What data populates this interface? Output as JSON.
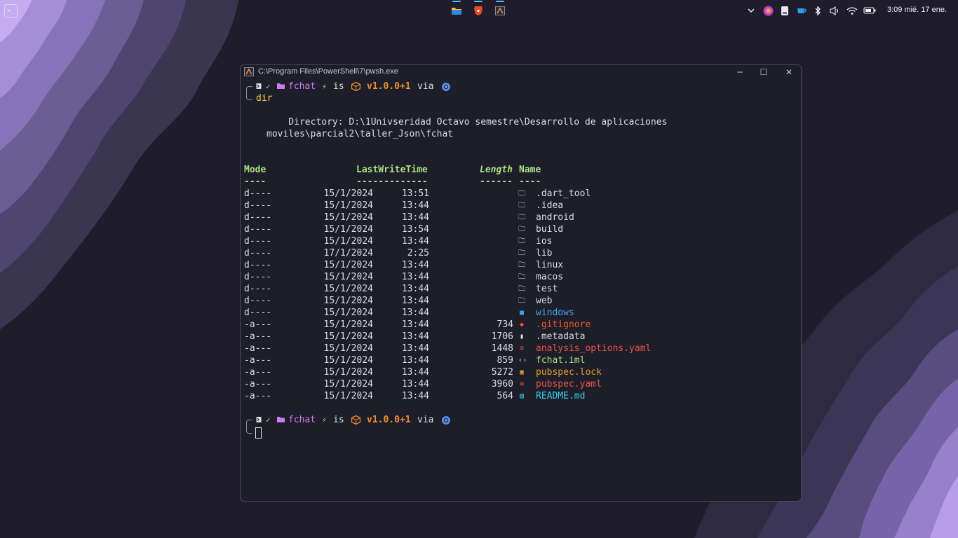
{
  "taskbar": {
    "apps": [
      {
        "name": "file-explorer",
        "icon": "folder-icon"
      },
      {
        "name": "brave-browser",
        "icon": "brave-lion-icon"
      },
      {
        "name": "terminal",
        "icon": "terminal-app-icon"
      }
    ],
    "tray_icons": [
      "chevron-up-icon",
      "app-tray-icon",
      "usb-drive-icon",
      "cup-icon",
      "bluetooth-icon",
      "volume-icon",
      "wifi-icon",
      "battery-icon"
    ],
    "clock": "3:09  mié. 17 ene."
  },
  "window": {
    "title": "C:\\Program Files\\PowerShell\\7\\pwsh.exe",
    "controls": {
      "minimize": "─",
      "maximize": "☐",
      "close": "✕"
    }
  },
  "terminal": {
    "prompt": {
      "segment_check": "✓",
      "dir": "fchat",
      "bolt": "⚡",
      "is": "is",
      "version": "v1.0.0+1",
      "via": "via"
    },
    "command": "dir",
    "directory_line1": "    Directory: D:\\1Univseridad Octavo semestre\\Desarrollo de aplicaciones",
    "directory_line2": "moviles\\parcial2\\taller_Json\\fchat",
    "headers": {
      "mode": "Mode",
      "lastwrite": "LastWriteTime",
      "length": "Length",
      "name": "Name"
    },
    "header_underlines": {
      "mode": "----",
      "lastwrite": "-------------",
      "length": "------",
      "name": "----"
    },
    "entries": [
      {
        "mode": "d----",
        "date": "15/1/2024",
        "time": "13:51",
        "length": "",
        "icon": "folder-icon",
        "name": ".dart_tool",
        "color": "#dcdce6"
      },
      {
        "mode": "d----",
        "date": "15/1/2024",
        "time": "13:44",
        "length": "",
        "icon": "folder-icon",
        "name": ".idea",
        "color": "#dcdce6"
      },
      {
        "mode": "d----",
        "date": "15/1/2024",
        "time": "13:44",
        "length": "",
        "icon": "folder-icon",
        "name": "android",
        "color": "#dcdce6"
      },
      {
        "mode": "d----",
        "date": "15/1/2024",
        "time": "13:54",
        "length": "",
        "icon": "folder-icon",
        "name": "build",
        "color": "#dcdce6"
      },
      {
        "mode": "d----",
        "date": "15/1/2024",
        "time": "13:44",
        "length": "",
        "icon": "folder-icon",
        "name": "ios",
        "color": "#dcdce6"
      },
      {
        "mode": "d----",
        "date": "17/1/2024",
        "time": "2:25",
        "length": "",
        "icon": "folder-icon",
        "name": "lib",
        "color": "#dcdce6"
      },
      {
        "mode": "d----",
        "date": "15/1/2024",
        "time": "13:44",
        "length": "",
        "icon": "folder-icon",
        "name": "linux",
        "color": "#dcdce6"
      },
      {
        "mode": "d----",
        "date": "15/1/2024",
        "time": "13:44",
        "length": "",
        "icon": "folder-icon",
        "name": "macos",
        "color": "#dcdce6"
      },
      {
        "mode": "d----",
        "date": "15/1/2024",
        "time": "13:44",
        "length": "",
        "icon": "folder-icon",
        "name": "test",
        "color": "#dcdce6"
      },
      {
        "mode": "d----",
        "date": "15/1/2024",
        "time": "13:44",
        "length": "",
        "icon": "folder-icon",
        "name": "web",
        "color": "#dcdce6"
      },
      {
        "mode": "d----",
        "date": "15/1/2024",
        "time": "13:44",
        "length": "",
        "icon": "windows-icon",
        "name": "windows",
        "color": "#3aa6e8"
      },
      {
        "mode": "-a---",
        "date": "15/1/2024",
        "time": "13:44",
        "length": "734",
        "icon": "git-icon",
        "name": ".gitignore",
        "color": "#f0582a"
      },
      {
        "mode": "-a---",
        "date": "15/1/2024",
        "time": "13:44",
        "length": "1706",
        "icon": "file-icon",
        "name": ".metadata",
        "color": "#dcdce6"
      },
      {
        "mode": "-a---",
        "date": "15/1/2024",
        "time": "13:44",
        "length": "1448",
        "icon": "yaml-icon",
        "name": "analysis_options.yaml",
        "color": "#e8534a"
      },
      {
        "mode": "-a---",
        "date": "15/1/2024",
        "time": "13:44",
        "length": "859",
        "icon": "code-icon",
        "name": "fchat.iml",
        "color": "#a6e37f"
      },
      {
        "mode": "-a---",
        "date": "15/1/2024",
        "time": "13:44",
        "length": "5272",
        "icon": "lock-icon",
        "name": "pubspec.lock",
        "color": "#e0a030"
      },
      {
        "mode": "-a---",
        "date": "15/1/2024",
        "time": "13:44",
        "length": "3960",
        "icon": "yaml-icon",
        "name": "pubspec.yaml",
        "color": "#e8534a"
      },
      {
        "mode": "-a---",
        "date": "15/1/2024",
        "time": "13:44",
        "length": "564",
        "icon": "markdown-icon",
        "name": "README.md",
        "color": "#2dd3e6"
      }
    ]
  },
  "colors": {
    "prompt_dir": "#c97ee8",
    "prompt_version": "#f0902a",
    "prompt_bolt": "#f5d142",
    "header": "#a6e37f",
    "check": "#a6e37f",
    "folder_icon": "#dcdce6"
  }
}
